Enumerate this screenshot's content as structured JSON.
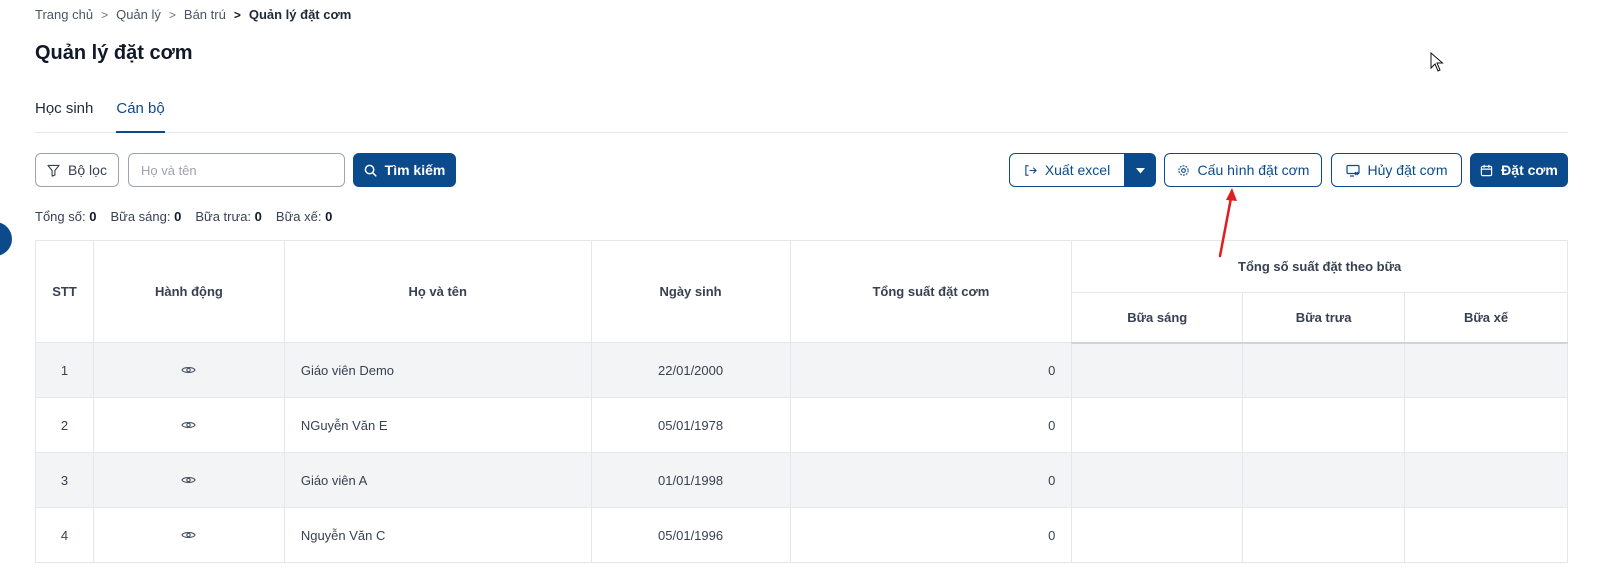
{
  "breadcrumb": {
    "items": [
      "Trang chủ",
      "Quản lý",
      "Bán trú"
    ],
    "current": "Quản lý đặt cơm"
  },
  "page": {
    "title": "Quản lý đặt cơm"
  },
  "tabs": [
    {
      "label": "Học sinh",
      "active": false
    },
    {
      "label": "Cán bộ",
      "active": true
    }
  ],
  "toolbar": {
    "filter_label": "Bộ lọc",
    "search_placeholder": "Họ và tên",
    "search_value": "",
    "search_button": "Tìm kiếm",
    "export_label": "Xuất excel",
    "config_label": "Cấu hình đặt cơm",
    "cancel_label": "Hủy đặt cơm",
    "order_label": "Đặt cơm"
  },
  "stats": {
    "total_label": "Tổng số:",
    "total_value": "0",
    "breakfast_label": "Bữa sáng:",
    "breakfast_value": "0",
    "lunch_label": "Bữa trưa:",
    "lunch_value": "0",
    "snack_label": "Bữa xế:",
    "snack_value": "0"
  },
  "table": {
    "headers": {
      "stt": "STT",
      "action": "Hành động",
      "name": "Họ và tên",
      "dob": "Ngày sinh",
      "total": "Tổng suất đặt cơm",
      "group": "Tổng số suất đặt theo bữa",
      "breakfast": "Bữa sáng",
      "lunch": "Bữa trưa",
      "snack": "Bữa xế"
    },
    "rows": [
      {
        "stt": "1",
        "name": "Giáo viên Demo",
        "dob": "22/01/2000",
        "total": "0",
        "breakfast": "",
        "lunch": "",
        "snack": ""
      },
      {
        "stt": "2",
        "name": "NGuyễn Văn E",
        "dob": "05/01/1978",
        "total": "0",
        "breakfast": "",
        "lunch": "",
        "snack": ""
      },
      {
        "stt": "3",
        "name": "Giáo viên A",
        "dob": "01/01/1998",
        "total": "0",
        "breakfast": "",
        "lunch": "",
        "snack": ""
      },
      {
        "stt": "4",
        "name": "Nguyễn Văn C",
        "dob": "05/01/1996",
        "total": "0",
        "breakfast": "",
        "lunch": "",
        "snack": ""
      }
    ]
  },
  "icons": {
    "filter": "filter-icon",
    "search": "search-icon",
    "export": "export-icon",
    "caret": "caret-down-icon",
    "gear": "gear-icon",
    "cancel": "cancel-order-icon",
    "calendar": "calendar-icon",
    "eye": "eye-icon"
  },
  "colors": {
    "primary": "#0b4a8b",
    "annotation": "#e11d1d",
    "row_alt": "#f3f4f6"
  }
}
